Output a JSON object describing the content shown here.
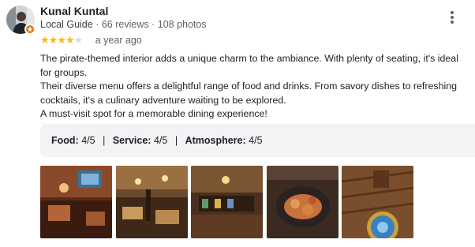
{
  "author": {
    "name": "Kunal Kuntal",
    "guide_label": "Local Guide",
    "reviews": "66 reviews",
    "photos": "108 photos",
    "dot": "·"
  },
  "review": {
    "rating": 4,
    "max_rating": 5,
    "time": "a year ago",
    "paragraphs": [
      "The pirate-themed interior adds a unique charm to the ambiance. With plenty of seating, it's ideal for groups.",
      "Their diverse menu offers a delightful range of food and drinks. From savory dishes to refreshing cocktails, it's a culinary adventure waiting to be explored.",
      "A must-visit spot for a memorable dining experience!"
    ]
  },
  "sub_ratings": [
    {
      "label": "Food:",
      "value": "4/5"
    },
    {
      "label": "Service:",
      "value": "4/5"
    },
    {
      "label": "Atmosphere:",
      "value": "4/5"
    }
  ],
  "separator": "|",
  "photos": [
    {
      "icon": "pirate-bar-interior-photo"
    },
    {
      "icon": "dining-hall-photo"
    },
    {
      "icon": "bar-counter-photo"
    },
    {
      "icon": "food-plate-photo"
    },
    {
      "icon": "porthole-decor-photo"
    }
  ],
  "colors": {
    "star": "#fbbc04",
    "star_empty": "#dadce0",
    "badge": "#e8710a",
    "ratings_bg": "#f1f3f4"
  },
  "icons": {
    "menu": "more-vert-icon",
    "badge": "local-guide-badge-icon"
  }
}
